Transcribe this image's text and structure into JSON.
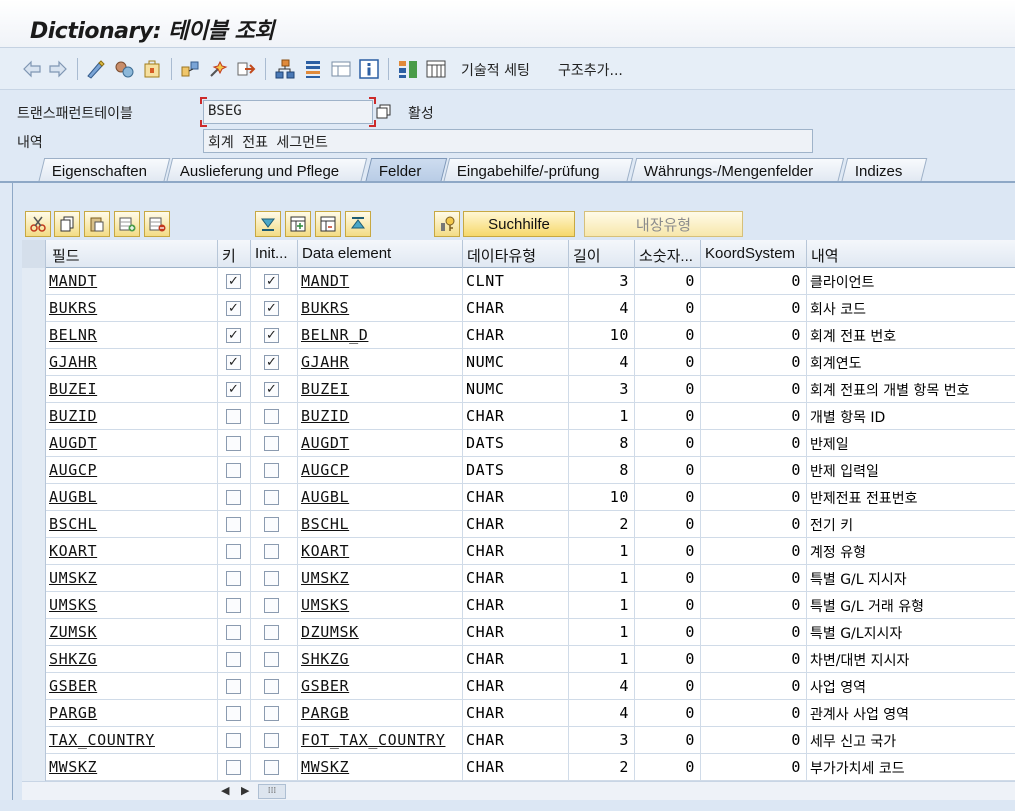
{
  "window": {
    "title": "Dictionary: 테이블 조회"
  },
  "toolbar": {
    "icons": [
      "back-arrow-icon",
      "forward-arrow-icon",
      "display-change-icon",
      "other-object-icon",
      "activate-icon",
      "where-used-icon",
      "object-list-icon",
      "navigate-icon",
      "hierarchy-icon",
      "sort-icon",
      "layout-icon",
      "info-icon",
      "technical-icon",
      "table-contents-icon"
    ],
    "technical_settings_label": "기술적 세팅",
    "append_structure_label": "구조추가..."
  },
  "form": {
    "table_label": "트랜스패런트테이블",
    "table_value": "BSEG",
    "status": "활성",
    "desc_label": "내역",
    "desc_value": "회계 전표 세그먼트"
  },
  "tabs": [
    {
      "label": "Eigenschaften",
      "active": false
    },
    {
      "label": "Auslieferung und Pflege",
      "active": false
    },
    {
      "label": "Felder",
      "active": true
    },
    {
      "label": "Eingabehilfe/-prüfung",
      "active": false
    },
    {
      "label": "Währungs-/Mengenfelder",
      "active": false
    },
    {
      "label": "Indizes",
      "active": false
    }
  ],
  "buttons": {
    "search_help": "Suchhilfe",
    "builtin_type": "내장유형"
  },
  "columns": {
    "field": "필드",
    "key": "키",
    "initial": "Init...",
    "data_element": "Data element",
    "data_type": "데이타유형",
    "length": "길이",
    "decimals": "소숫자...",
    "coord": "KoordSystem",
    "desc": "내역"
  },
  "rows": [
    {
      "field": "MANDT",
      "key": true,
      "init": true,
      "de": "MANDT",
      "type": "CLNT",
      "len": "3",
      "dec": "0",
      "coord": "0",
      "desc": "클라이언트"
    },
    {
      "field": "BUKRS",
      "key": true,
      "init": true,
      "de": "BUKRS",
      "type": "CHAR",
      "len": "4",
      "dec": "0",
      "coord": "0",
      "desc": "회사 코드"
    },
    {
      "field": "BELNR",
      "key": true,
      "init": true,
      "de": "BELNR_D",
      "type": "CHAR",
      "len": "10",
      "dec": "0",
      "coord": "0",
      "desc": "회계 전표 번호"
    },
    {
      "field": "GJAHR",
      "key": true,
      "init": true,
      "de": "GJAHR",
      "type": "NUMC",
      "len": "4",
      "dec": "0",
      "coord": "0",
      "desc": "회계연도"
    },
    {
      "field": "BUZEI",
      "key": true,
      "init": true,
      "de": "BUZEI",
      "type": "NUMC",
      "len": "3",
      "dec": "0",
      "coord": "0",
      "desc": "회계 전표의 개별 항목 번호"
    },
    {
      "field": "BUZID",
      "key": false,
      "init": false,
      "de": "BUZID",
      "type": "CHAR",
      "len": "1",
      "dec": "0",
      "coord": "0",
      "desc": "개별 항목 ID"
    },
    {
      "field": "AUGDT",
      "key": false,
      "init": false,
      "de": "AUGDT",
      "type": "DATS",
      "len": "8",
      "dec": "0",
      "coord": "0",
      "desc": "반제일"
    },
    {
      "field": "AUGCP",
      "key": false,
      "init": false,
      "de": "AUGCP",
      "type": "DATS",
      "len": "8",
      "dec": "0",
      "coord": "0",
      "desc": "반제 입력일"
    },
    {
      "field": "AUGBL",
      "key": false,
      "init": false,
      "de": "AUGBL",
      "type": "CHAR",
      "len": "10",
      "dec": "0",
      "coord": "0",
      "desc": "반제전표 전표번호"
    },
    {
      "field": "BSCHL",
      "key": false,
      "init": false,
      "de": "BSCHL",
      "type": "CHAR",
      "len": "2",
      "dec": "0",
      "coord": "0",
      "desc": "전기 키"
    },
    {
      "field": "KOART",
      "key": false,
      "init": false,
      "de": "KOART",
      "type": "CHAR",
      "len": "1",
      "dec": "0",
      "coord": "0",
      "desc": "계정 유형"
    },
    {
      "field": "UMSKZ",
      "key": false,
      "init": false,
      "de": "UMSKZ",
      "type": "CHAR",
      "len": "1",
      "dec": "0",
      "coord": "0",
      "desc": "특별 G/L 지시자"
    },
    {
      "field": "UMSKS",
      "key": false,
      "init": false,
      "de": "UMSKS",
      "type": "CHAR",
      "len": "1",
      "dec": "0",
      "coord": "0",
      "desc": "특별 G/L 거래 유형"
    },
    {
      "field": "ZUMSK",
      "key": false,
      "init": false,
      "de": "DZUMSK",
      "type": "CHAR",
      "len": "1",
      "dec": "0",
      "coord": "0",
      "desc": "특별 G/L지시자"
    },
    {
      "field": "SHKZG",
      "key": false,
      "init": false,
      "de": "SHKZG",
      "type": "CHAR",
      "len": "1",
      "dec": "0",
      "coord": "0",
      "desc": "차변/대변 지시자"
    },
    {
      "field": "GSBER",
      "key": false,
      "init": false,
      "de": "GSBER",
      "type": "CHAR",
      "len": "4",
      "dec": "0",
      "coord": "0",
      "desc": "사업 영역"
    },
    {
      "field": "PARGB",
      "key": false,
      "init": false,
      "de": "PARGB",
      "type": "CHAR",
      "len": "4",
      "dec": "0",
      "coord": "0",
      "desc": "관계사 사업 영역"
    },
    {
      "field": "TAX_COUNTRY",
      "key": false,
      "init": false,
      "de": "FOT_TAX_COUNTRY",
      "type": "CHAR",
      "len": "3",
      "dec": "0",
      "coord": "0",
      "desc": "세무 신고 국가"
    },
    {
      "field": "MWSKZ",
      "key": false,
      "init": false,
      "de": "MWSKZ",
      "type": "CHAR",
      "len": "2",
      "dec": "0",
      "coord": "0",
      "desc": "부가가치세 코드"
    }
  ],
  "checkmark": "✓"
}
